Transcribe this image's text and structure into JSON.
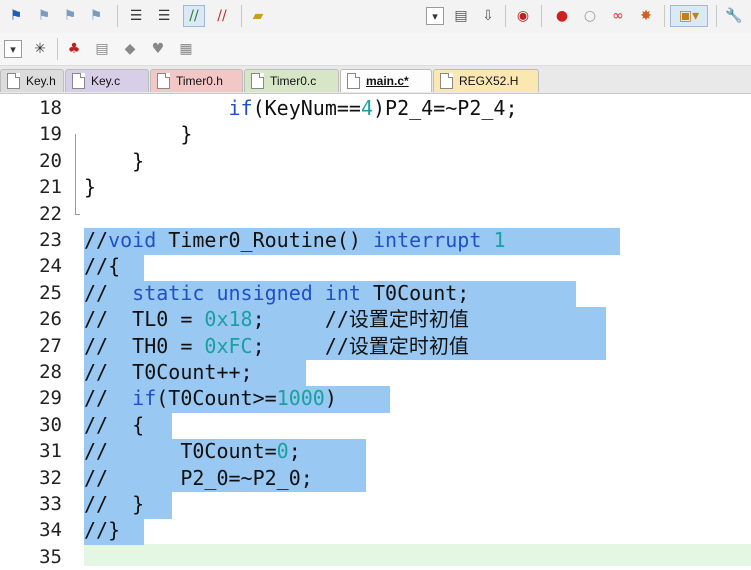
{
  "toolbar1": {
    "icons": [
      "bookmark-icon",
      "bookmark-prev-icon",
      "bookmark-next-icon",
      "bookmark-clear-icon",
      "indent-icon",
      "unindent-icon",
      "comment-icon",
      "uncomment-icon",
      "open-folder-icon",
      "target-dropdown",
      "file-manage-icon",
      "download-icon",
      "debug-icon",
      "breakpoint-insert-icon",
      "breakpoint-enable-icon",
      "breakpoint-disable-icon",
      "breakpoint-kill-icon",
      "window-layout-icon",
      "wrench-icon"
    ]
  },
  "toolbar2": {
    "icons": [
      "dropdown-arrow",
      "magic-wand-icon",
      "options-icon",
      "build-icon",
      "copy-target-icon",
      "batch-icon",
      "rebuild-icon"
    ]
  },
  "tabs": [
    {
      "label": "Key.h",
      "color": "#dcdcdc"
    },
    {
      "label": "Key.c",
      "color": "#d7cfe8"
    },
    {
      "label": "Timer0.h",
      "color": "#f4c7c7"
    },
    {
      "label": "Timer0.c",
      "color": "#d8e6c8"
    },
    {
      "label": "main.c*",
      "color": "#fdfdfd",
      "active": true
    },
    {
      "label": "REGX52.H",
      "color": "#fbe7b0"
    }
  ],
  "code": [
    {
      "n": "18",
      "text": "            if(KeyNum==4)P2_4=~P2_4;"
    },
    {
      "n": "19",
      "text": "        }"
    },
    {
      "n": "20",
      "text": "    }"
    },
    {
      "n": "21",
      "text": "}"
    },
    {
      "n": "22",
      "text": ""
    },
    {
      "n": "23",
      "text": "//void Timer0_Routine() interrupt 1"
    },
    {
      "n": "24",
      "text": "//{"
    },
    {
      "n": "25",
      "text": "//  static unsigned int T0Count;"
    },
    {
      "n": "26",
      "text": "//  TL0 = 0x18;     //设置定时初值"
    },
    {
      "n": "27",
      "text": "//  TH0 = 0xFC;     //设置定时初值"
    },
    {
      "n": "28",
      "text": "//  T0Count++;"
    },
    {
      "n": "29",
      "text": "//  if(T0Count>=1000)"
    },
    {
      "n": "30",
      "text": "//  {"
    },
    {
      "n": "31",
      "text": "//      T0Count=0;"
    },
    {
      "n": "32",
      "text": "//      P2_0=~P2_0;"
    },
    {
      "n": "33",
      "text": "//  }"
    },
    {
      "n": "34",
      "text": "//}"
    },
    {
      "n": "35",
      "text": ""
    }
  ],
  "colors": {
    "selection": "#99c9f2",
    "keyword": "#2050c8",
    "number": "#1aa0a0"
  }
}
